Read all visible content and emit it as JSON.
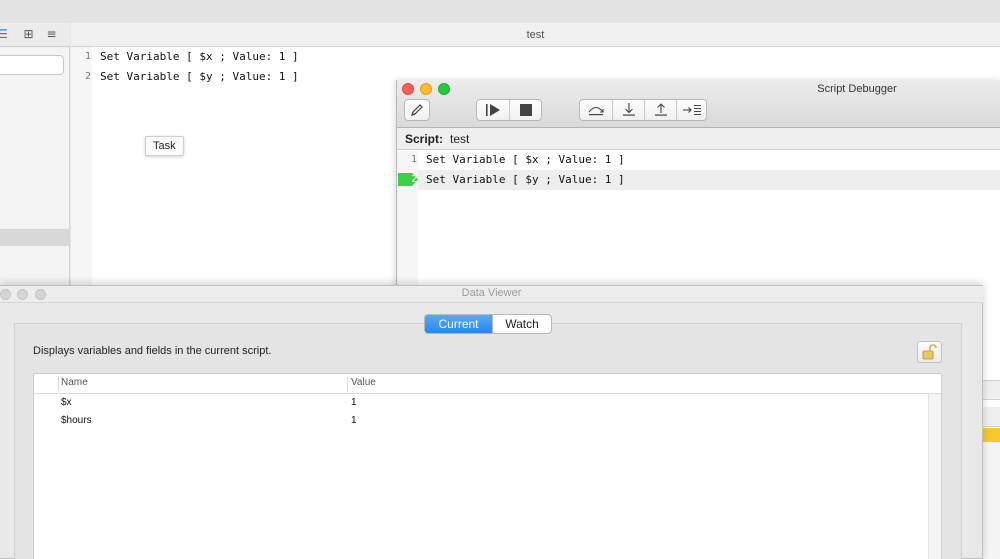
{
  "workspace": {
    "script_title": "test",
    "lines": [
      {
        "num": "1",
        "text": "Set Variable [ $x ; Value: 1 ]"
      },
      {
        "num": "2",
        "text": "Set Variable [ $y ; Value: 1 ]"
      }
    ],
    "tooltip": "Task",
    "sidebar_icons": [
      "list-icon",
      "add-folder-icon",
      "menu-lines-icon"
    ]
  },
  "debugger": {
    "title": "Script Debugger",
    "script_label": "Script:",
    "script_name": "test",
    "lines": [
      {
        "num": "1",
        "text": "Set Variable [ $x ; Value: 1 ]"
      },
      {
        "num": "2",
        "text": "Set Variable [ $y ; Value: 1 ]"
      }
    ],
    "current_line": "2",
    "toolbar_icons": [
      "edit-pencil-icon",
      "run-icon",
      "halt-icon",
      "step-over-icon",
      "step-into-icon",
      "step-out-icon",
      "set-next-step-icon"
    ]
  },
  "data_viewer": {
    "title": "Data Viewer",
    "tabs": [
      {
        "label": "Current",
        "selected": true
      },
      {
        "label": "Watch",
        "selected": false
      }
    ],
    "description": "Displays variables and fields in the current script.",
    "columns": [
      "Name",
      "Value"
    ],
    "rows": [
      {
        "name": "$x",
        "value": "1"
      },
      {
        "name": "$hours",
        "value": "1"
      }
    ]
  },
  "colors": {
    "accent_blue": "#2c86ee",
    "close_red": "#fc5f57",
    "minimize_yellow": "#fdbc2e",
    "zoom_green": "#2ac840",
    "current_line_green": "#3ccf47"
  }
}
